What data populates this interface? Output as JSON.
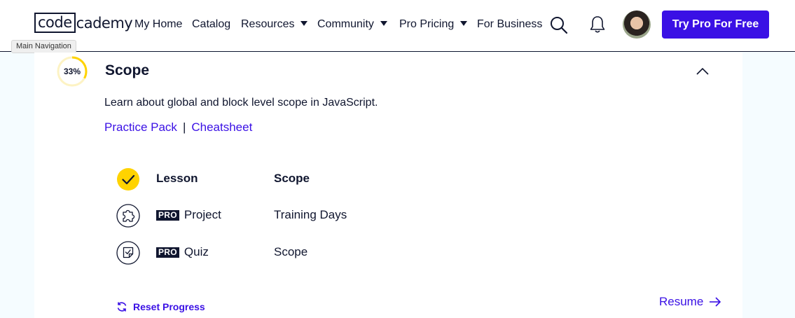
{
  "header": {
    "logo_left": "code",
    "logo_right": "cademy",
    "nav": {
      "my_home": "My Home",
      "catalog": "Catalog",
      "resources": "Resources",
      "community": "Community",
      "pro_pricing": "Pro Pricing",
      "for_business": "For Business"
    },
    "cta_label": "Try Pro For Free",
    "tooltip": "Main Navigation"
  },
  "section": {
    "progress": "33%",
    "progress_fraction": 0.33,
    "title": "Scope",
    "description": "Learn about global and block level scope in JavaScript.",
    "link_practice": "Practice Pack",
    "link_separator": "|",
    "link_cheatsheet": "Cheatsheet",
    "items": [
      {
        "type": "Lesson",
        "name": "Scope",
        "pro_badge": "",
        "status": "completed",
        "icon": "check-icon"
      },
      {
        "type": "Project",
        "name": "Training Days",
        "pro_badge": "PRO",
        "status": "locked",
        "icon": "puzzle-icon"
      },
      {
        "type": "Quiz",
        "name": "Scope",
        "pro_badge": "PRO",
        "status": "locked",
        "icon": "quiz-icon"
      }
    ],
    "reset_label": "Reset Progress",
    "resume_label": "Resume"
  },
  "colors": {
    "brand_primary": "#3a10e5",
    "progress_yellow": "#ffd300",
    "text_dark": "#10162f",
    "page_bg": "#f5fcff"
  }
}
